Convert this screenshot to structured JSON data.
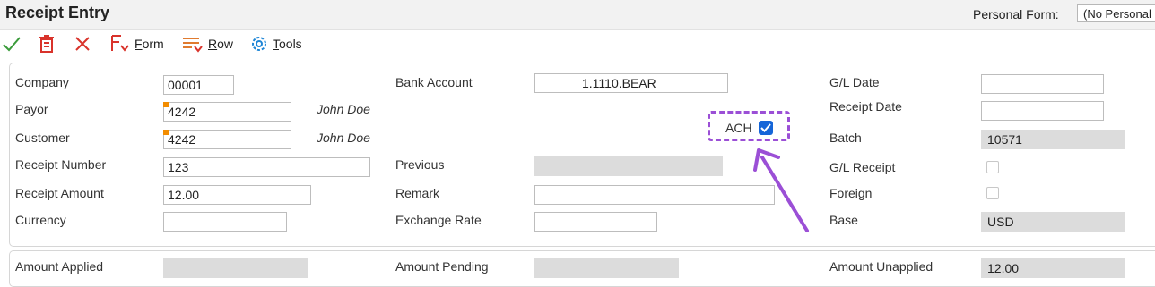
{
  "window": {
    "title": "Receipt Entry"
  },
  "personal_form": {
    "label": "Personal Form:",
    "value": "(No Personal Form)"
  },
  "toolbar": {
    "form": {
      "accel": "F",
      "rest": "orm"
    },
    "row": {
      "accel": "R",
      "rest": "ow"
    },
    "tools": {
      "accel": "T",
      "rest": "ools"
    }
  },
  "header": {
    "company": {
      "label": "Company",
      "value": "00001"
    },
    "payor": {
      "label": "Payor",
      "value": "4242",
      "name": "John Doe"
    },
    "customer": {
      "label": "Customer",
      "value": "4242",
      "name": "John Doe"
    },
    "receipt_number": {
      "label": "Receipt Number",
      "value": "123"
    },
    "receipt_amount": {
      "label": "Receipt Amount",
      "value": "12.00"
    },
    "currency": {
      "label": "Currency",
      "value": ""
    },
    "bank_account": {
      "label": "Bank Account",
      "value": "1.1110.BEAR"
    },
    "ach": {
      "label": "ACH",
      "checked": true
    },
    "previous": {
      "label": "Previous",
      "value": ""
    },
    "remark": {
      "label": "Remark",
      "value": ""
    },
    "exchange_rate": {
      "label": "Exchange Rate",
      "value": ""
    },
    "gl_date": {
      "label": "G/L Date",
      "value": ""
    },
    "receipt_date": {
      "label": "Receipt Date",
      "value": ""
    },
    "batch": {
      "label": "Batch",
      "value": "10571"
    },
    "gl_receipt": {
      "label": "G/L Receipt",
      "checked": false
    },
    "foreign": {
      "label": "Foreign",
      "checked": false
    },
    "base": {
      "label": "Base",
      "value": "USD"
    }
  },
  "totals": {
    "amount_applied": {
      "label": "Amount Applied",
      "value": ""
    },
    "amount_pending": {
      "label": "Amount Pending",
      "value": ""
    },
    "amount_unapplied": {
      "label": "Amount Unapplied",
      "value": "12.00"
    }
  },
  "annotation": {
    "color": "#9b4fd6"
  },
  "colors": {
    "accent": "#1565d8",
    "check_green": "#3a9b3a",
    "delete_red": "#d9332b",
    "required_marker": "#f28c00"
  }
}
